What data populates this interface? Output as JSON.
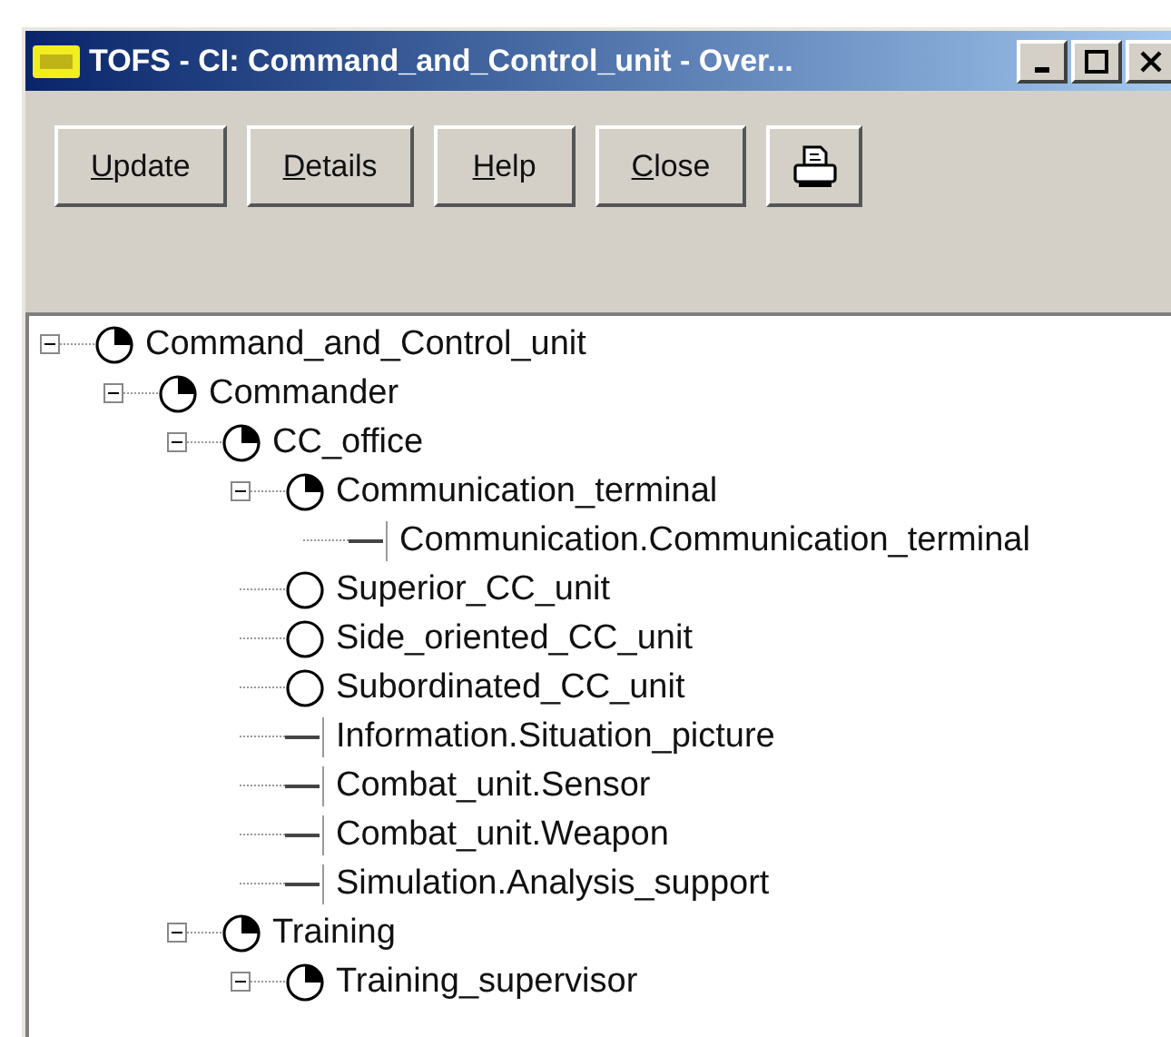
{
  "window": {
    "title": "TOFS - CI: Command_and_Control_unit - Over..."
  },
  "toolbar": {
    "buttons": [
      {
        "label": "Update",
        "kind": "text"
      },
      {
        "label": "Details",
        "kind": "text"
      },
      {
        "label": "Help",
        "kind": "text"
      },
      {
        "label": "Close",
        "kind": "text"
      },
      {
        "kind": "print"
      }
    ]
  },
  "tree": {
    "items": [
      {
        "label": "Command_and_Control_unit",
        "kind": "pie",
        "expanded": true,
        "children": [
          {
            "label": "Commander",
            "kind": "pie",
            "expanded": true,
            "children": [
              {
                "label": "CC_office",
                "kind": "pie",
                "expanded": true,
                "children": [
                  {
                    "label": "Communication_terminal",
                    "kind": "pie",
                    "expanded": true,
                    "children": [
                      {
                        "label": "Communication.Communication_terminal",
                        "kind": "line"
                      }
                    ]
                  },
                  {
                    "label": "Superior_CC_unit",
                    "kind": "circle"
                  },
                  {
                    "label": "Side_oriented_CC_unit",
                    "kind": "circle"
                  },
                  {
                    "label": "Subordinated_CC_unit",
                    "kind": "circle"
                  },
                  {
                    "label": "Information.Situation_picture",
                    "kind": "line"
                  },
                  {
                    "label": "Combat_unit.Sensor",
                    "kind": "line"
                  },
                  {
                    "label": "Combat_unit.Weapon",
                    "kind": "line"
                  },
                  {
                    "label": "Simulation.Analysis_support",
                    "kind": "line"
                  }
                ]
              },
              {
                "label": "Training",
                "kind": "pie",
                "expanded": true,
                "children": [
                  {
                    "label": "Training_supervisor",
                    "kind": "pie",
                    "expanded": true
                  }
                ]
              }
            ]
          }
        ]
      }
    ]
  }
}
